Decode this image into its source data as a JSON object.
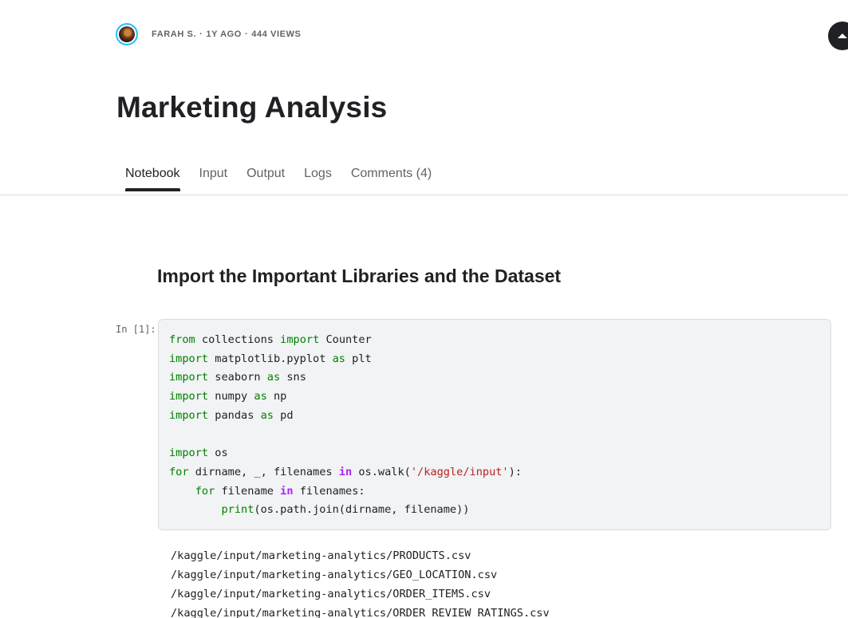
{
  "meta": {
    "author": "FARAH S.",
    "age": "1Y AGO",
    "views": "444 VIEWS",
    "separator": "·"
  },
  "title": "Marketing Analysis",
  "tabs": [
    {
      "label": "Notebook",
      "active": true
    },
    {
      "label": "Input",
      "active": false
    },
    {
      "label": "Output",
      "active": false
    },
    {
      "label": "Logs",
      "active": false
    },
    {
      "label": "Comments (4)",
      "active": false
    }
  ],
  "section_heading": "Import the Important Libraries and the Dataset",
  "cell": {
    "prompt": "In [1]:",
    "code": {
      "line1": {
        "k1": "from",
        "t1": " collections ",
        "k2": "import",
        "t2": " Counter"
      },
      "line2": {
        "k1": "import",
        "t1": " matplotlib.pyplot ",
        "k2": "as",
        "t2": " plt"
      },
      "line3": {
        "k1": "import",
        "t1": " seaborn ",
        "k2": "as",
        "t2": " sns"
      },
      "line4": {
        "k1": "import",
        "t1": " numpy ",
        "k2": "as",
        "t2": " np"
      },
      "line5": {
        "k1": "import",
        "t1": " pandas ",
        "k2": "as",
        "t2": " pd"
      },
      "line7": {
        "k1": "import",
        "t1": " os"
      },
      "line8": {
        "k1": "for",
        "t1": " dirname, _, filenames ",
        "k2": "in",
        "t2": " os.walk(",
        "s1": "'/kaggle/input'",
        "t3": "):"
      },
      "line9": {
        "indent": "    ",
        "k1": "for",
        "t1": " filename ",
        "k2": "in",
        "t2": " filenames:"
      },
      "line10": {
        "indent": "        ",
        "f1": "print",
        "t1": "(os.path.join(dirname, filename))"
      }
    }
  },
  "output_lines": [
    "/kaggle/input/marketing-analytics/PRODUCTS.csv",
    "/kaggle/input/marketing-analytics/GEO_LOCATION.csv",
    "/kaggle/input/marketing-analytics/ORDER_ITEMS.csv",
    "/kaggle/input/marketing-analytics/ORDER_REVIEW_RATINGS.csv"
  ],
  "icons": {
    "avatar": "user-avatar",
    "scroll_top": "caret-up-icon"
  },
  "colors": {
    "avatar_ring": "#20beff",
    "keyword": "#008000",
    "keyword_in": "#aa22ff",
    "string": "#ba2121",
    "cell_bg": "#f1f3f4"
  }
}
